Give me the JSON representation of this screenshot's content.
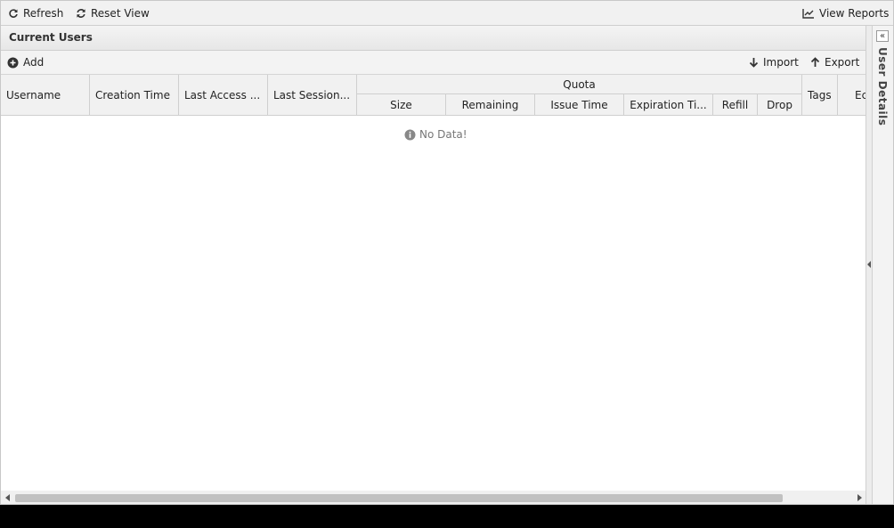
{
  "toolbar": {
    "refresh_label": "Refresh",
    "reset_view_label": "Reset View",
    "view_reports_label": "View Reports"
  },
  "panel": {
    "title": "Current Users",
    "add_label": "Add",
    "import_label": "Import",
    "export_label": "Export"
  },
  "grid": {
    "columns": {
      "username": "Username",
      "creation_time": "Creation Time",
      "last_access": "Last Access ...",
      "last_session": "Last Session...",
      "quota": "Quota",
      "size": "Size",
      "remaining": "Remaining",
      "issue_time": "Issue Time",
      "expiration_time": "Expiration Ti...",
      "refill": "Refill",
      "drop": "Drop",
      "tags": "Tags",
      "edit": "Ec"
    },
    "empty_text": "No Data!"
  },
  "side_panel": {
    "title": "User Details",
    "collapse_glyph": "«"
  },
  "colors": {
    "toolbar_bg": "#f1f1f1",
    "border": "#cfcfcf",
    "scroll_thumb": "#c1c1c1"
  }
}
